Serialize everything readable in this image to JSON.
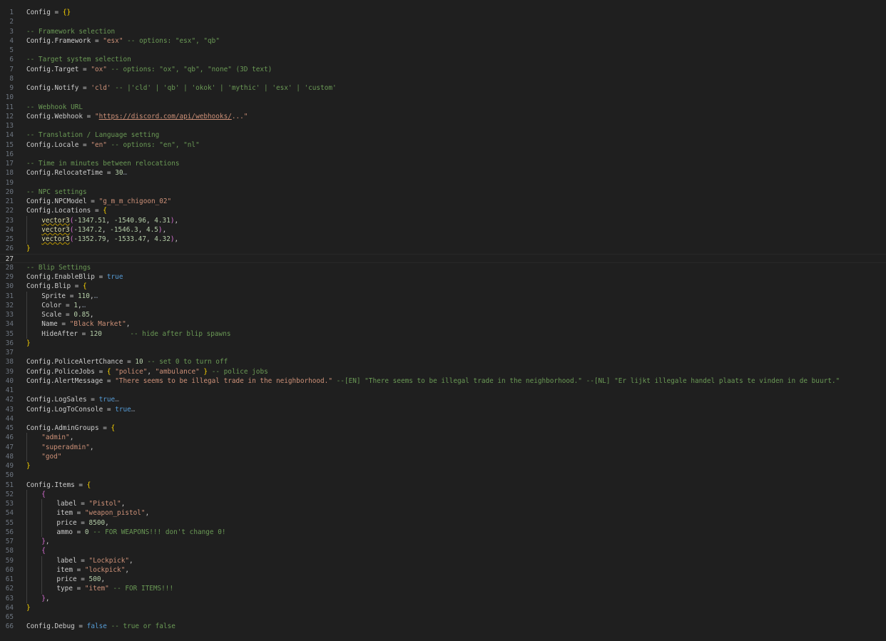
{
  "editor": {
    "colors": {
      "background": "#1f1f1f",
      "text": "#cccccc",
      "line_number": "#6e7681",
      "string": "#ce9178",
      "number": "#b5cea8",
      "comment": "#6a9955",
      "keyword": "#569cd6",
      "bracket_level1": "#ffd700",
      "bracket_level2": "#da70d6",
      "function": "#dcdcaa"
    },
    "current_line": 27,
    "lines": [
      {
        "n": 1,
        "indent": 0,
        "tokens": [
          [
            "id",
            "Config = "
          ],
          [
            "br1",
            "{}"
          ]
        ]
      },
      {
        "n": 2,
        "indent": 0,
        "tokens": []
      },
      {
        "n": 3,
        "indent": 0,
        "tokens": [
          [
            "cmt",
            "-- Framework selection"
          ]
        ]
      },
      {
        "n": 4,
        "indent": 0,
        "tokens": [
          [
            "id",
            "Config.Framework = "
          ],
          [
            "str",
            "\"esx\""
          ],
          [
            "id",
            " "
          ],
          [
            "cmt",
            "-- options: \"esx\", \"qb\""
          ]
        ]
      },
      {
        "n": 5,
        "indent": 0,
        "tokens": []
      },
      {
        "n": 6,
        "indent": 0,
        "tokens": [
          [
            "cmt",
            "-- Target system selection"
          ]
        ]
      },
      {
        "n": 7,
        "indent": 0,
        "tokens": [
          [
            "id",
            "Config.Target = "
          ],
          [
            "str",
            "\"ox\""
          ],
          [
            "id",
            " "
          ],
          [
            "cmt",
            "-- options: \"ox\", \"qb\", \"none\" (3D text)"
          ]
        ]
      },
      {
        "n": 8,
        "indent": 0,
        "tokens": []
      },
      {
        "n": 9,
        "indent": 0,
        "tokens": [
          [
            "id",
            "Config.Notify = "
          ],
          [
            "str",
            "'cld'"
          ],
          [
            "id",
            " "
          ],
          [
            "cmt",
            "-- |'cld' | 'qb' | 'okok' | 'mythic' | 'esx' | 'custom'"
          ]
        ]
      },
      {
        "n": 10,
        "indent": 0,
        "tokens": []
      },
      {
        "n": 11,
        "indent": 0,
        "tokens": [
          [
            "cmt",
            "-- Webhook URL"
          ]
        ]
      },
      {
        "n": 12,
        "indent": 0,
        "tokens": [
          [
            "id",
            "Config.Webhook = "
          ],
          [
            "str",
            "\""
          ],
          [
            "url",
            "https://discord.com/api/webhooks/"
          ],
          [
            "str",
            "...\""
          ]
        ]
      },
      {
        "n": 13,
        "indent": 0,
        "tokens": []
      },
      {
        "n": 14,
        "indent": 0,
        "tokens": [
          [
            "cmt",
            "-- Translation / Language setting"
          ]
        ]
      },
      {
        "n": 15,
        "indent": 0,
        "tokens": [
          [
            "id",
            "Config.Locale = "
          ],
          [
            "str",
            "\"en\""
          ],
          [
            "id",
            " "
          ],
          [
            "cmt",
            "-- options: \"en\", \"nl\""
          ]
        ]
      },
      {
        "n": 16,
        "indent": 0,
        "tokens": []
      },
      {
        "n": 17,
        "indent": 0,
        "tokens": [
          [
            "cmt",
            "-- Time in minutes between relocations"
          ]
        ]
      },
      {
        "n": 18,
        "indent": 0,
        "tokens": [
          [
            "id",
            "Config.RelocateTime = "
          ],
          [
            "num",
            "30"
          ],
          [
            "dots",
            "…"
          ]
        ]
      },
      {
        "n": 19,
        "indent": 0,
        "tokens": []
      },
      {
        "n": 20,
        "indent": 0,
        "tokens": [
          [
            "cmt",
            "-- NPC settings"
          ]
        ]
      },
      {
        "n": 21,
        "indent": 0,
        "tokens": [
          [
            "id",
            "Config.NPCModel = "
          ],
          [
            "str",
            "\"g_m_m_chigoon_02\""
          ]
        ]
      },
      {
        "n": 22,
        "indent": 0,
        "tokens": [
          [
            "id",
            "Config.Locations = "
          ],
          [
            "br1",
            "{"
          ]
        ]
      },
      {
        "n": 23,
        "indent": 1,
        "tokens": [
          [
            "fnsq",
            "vector3"
          ],
          [
            "br2",
            "("
          ],
          [
            "num",
            "-1347.51"
          ],
          [
            "id",
            ", "
          ],
          [
            "num",
            "-1540.96"
          ],
          [
            "id",
            ", "
          ],
          [
            "num",
            "4.31"
          ],
          [
            "br2",
            ")"
          ],
          [
            "id",
            ","
          ]
        ]
      },
      {
        "n": 24,
        "indent": 1,
        "tokens": [
          [
            "fnsq",
            "vector3"
          ],
          [
            "br2",
            "("
          ],
          [
            "num",
            "-1347.2"
          ],
          [
            "id",
            ", "
          ],
          [
            "num",
            "-1546.3"
          ],
          [
            "id",
            ", "
          ],
          [
            "num",
            "4.5"
          ],
          [
            "br2",
            ")"
          ],
          [
            "id",
            ","
          ]
        ]
      },
      {
        "n": 25,
        "indent": 1,
        "tokens": [
          [
            "fnsq",
            "vector3"
          ],
          [
            "br2",
            "("
          ],
          [
            "num",
            "-1352.79"
          ],
          [
            "id",
            ", "
          ],
          [
            "num",
            "-1533.47"
          ],
          [
            "id",
            ", "
          ],
          [
            "num",
            "4.32"
          ],
          [
            "br2",
            ")"
          ],
          [
            "id",
            ","
          ]
        ]
      },
      {
        "n": 26,
        "indent": 0,
        "tokens": [
          [
            "br1",
            "}"
          ]
        ]
      },
      {
        "n": 27,
        "indent": 0,
        "tokens": []
      },
      {
        "n": 28,
        "indent": 0,
        "tokens": [
          [
            "cmt",
            "-- Blip Settings"
          ]
        ]
      },
      {
        "n": 29,
        "indent": 0,
        "tokens": [
          [
            "id",
            "Config.EnableBlip = "
          ],
          [
            "kw",
            "true"
          ]
        ]
      },
      {
        "n": 30,
        "indent": 0,
        "tokens": [
          [
            "id",
            "Config.Blip = "
          ],
          [
            "br1",
            "{"
          ]
        ]
      },
      {
        "n": 31,
        "indent": 1,
        "tokens": [
          [
            "id",
            "Sprite = "
          ],
          [
            "num",
            "110"
          ],
          [
            "id",
            ","
          ],
          [
            "dots",
            "…"
          ]
        ]
      },
      {
        "n": 32,
        "indent": 1,
        "tokens": [
          [
            "id",
            "Color = "
          ],
          [
            "num",
            "1"
          ],
          [
            "id",
            ","
          ],
          [
            "dots",
            "…"
          ]
        ]
      },
      {
        "n": 33,
        "indent": 1,
        "tokens": [
          [
            "id",
            "Scale = "
          ],
          [
            "num",
            "0.85"
          ],
          [
            "id",
            ","
          ]
        ]
      },
      {
        "n": 34,
        "indent": 1,
        "tokens": [
          [
            "id",
            "Name = "
          ],
          [
            "str",
            "\"Black Market\""
          ],
          [
            "id",
            ","
          ]
        ]
      },
      {
        "n": 35,
        "indent": 1,
        "tokens": [
          [
            "id",
            "HideAfter = "
          ],
          [
            "num",
            "120"
          ],
          [
            "id",
            "       "
          ],
          [
            "cmt",
            "-- hide after blip spawns"
          ]
        ]
      },
      {
        "n": 36,
        "indent": 0,
        "tokens": [
          [
            "br1",
            "}"
          ]
        ]
      },
      {
        "n": 37,
        "indent": 0,
        "tokens": []
      },
      {
        "n": 38,
        "indent": 0,
        "tokens": [
          [
            "id",
            "Config.PoliceAlertChance = "
          ],
          [
            "num",
            "10"
          ],
          [
            "id",
            " "
          ],
          [
            "cmt",
            "-- set 0 to turn off"
          ]
        ]
      },
      {
        "n": 39,
        "indent": 0,
        "tokens": [
          [
            "id",
            "Config.PoliceJobs = "
          ],
          [
            "br1",
            "{"
          ],
          [
            "id",
            " "
          ],
          [
            "str",
            "\"police\""
          ],
          [
            "id",
            ", "
          ],
          [
            "str",
            "\"ambulance\""
          ],
          [
            "id",
            " "
          ],
          [
            "br1",
            "}"
          ],
          [
            "id",
            " "
          ],
          [
            "cmt",
            "-- police jobs"
          ]
        ]
      },
      {
        "n": 40,
        "indent": 0,
        "tokens": [
          [
            "id",
            "Config.AlertMessage = "
          ],
          [
            "str",
            "\"There seems to be illegal trade in the neighborhood.\""
          ],
          [
            "id",
            " "
          ],
          [
            "cmt",
            "--[EN] \"There seems to be illegal trade in the neighborhood.\" --[NL] \"Er lijkt illegale handel plaats te vinden in de buurt.\""
          ]
        ]
      },
      {
        "n": 41,
        "indent": 0,
        "tokens": []
      },
      {
        "n": 42,
        "indent": 0,
        "tokens": [
          [
            "id",
            "Config.LogSales = "
          ],
          [
            "kw",
            "true"
          ],
          [
            "dots",
            "…"
          ]
        ]
      },
      {
        "n": 43,
        "indent": 0,
        "tokens": [
          [
            "id",
            "Config.LogToConsole = "
          ],
          [
            "kw",
            "true"
          ],
          [
            "dots",
            "…"
          ]
        ]
      },
      {
        "n": 44,
        "indent": 0,
        "tokens": []
      },
      {
        "n": 45,
        "indent": 0,
        "tokens": [
          [
            "id",
            "Config.AdminGroups = "
          ],
          [
            "br1",
            "{"
          ]
        ]
      },
      {
        "n": 46,
        "indent": 1,
        "tokens": [
          [
            "str",
            "\"admin\""
          ],
          [
            "id",
            ","
          ]
        ]
      },
      {
        "n": 47,
        "indent": 1,
        "tokens": [
          [
            "str",
            "\"superadmin\""
          ],
          [
            "id",
            ","
          ]
        ]
      },
      {
        "n": 48,
        "indent": 1,
        "tokens": [
          [
            "str",
            "\"god\""
          ]
        ]
      },
      {
        "n": 49,
        "indent": 0,
        "tokens": [
          [
            "br1",
            "}"
          ]
        ]
      },
      {
        "n": 50,
        "indent": 0,
        "tokens": []
      },
      {
        "n": 51,
        "indent": 0,
        "tokens": [
          [
            "id",
            "Config.Items = "
          ],
          [
            "br1",
            "{"
          ]
        ]
      },
      {
        "n": 52,
        "indent": 1,
        "tokens": [
          [
            "br2",
            "{"
          ]
        ]
      },
      {
        "n": 53,
        "indent": 2,
        "tokens": [
          [
            "id",
            "label = "
          ],
          [
            "str",
            "\"Pistol\""
          ],
          [
            "id",
            ","
          ]
        ]
      },
      {
        "n": 54,
        "indent": 2,
        "tokens": [
          [
            "id",
            "item = "
          ],
          [
            "str",
            "\"weapon_pistol\""
          ],
          [
            "id",
            ","
          ]
        ]
      },
      {
        "n": 55,
        "indent": 2,
        "tokens": [
          [
            "id",
            "price = "
          ],
          [
            "num",
            "8500"
          ],
          [
            "id",
            ","
          ]
        ]
      },
      {
        "n": 56,
        "indent": 2,
        "tokens": [
          [
            "id",
            "ammo = "
          ],
          [
            "num",
            "0"
          ],
          [
            "id",
            " "
          ],
          [
            "cmt",
            "-- FOR WEAPONS!!! don't change 0!"
          ]
        ]
      },
      {
        "n": 57,
        "indent": 1,
        "tokens": [
          [
            "br2",
            "}"
          ],
          [
            "id",
            ","
          ]
        ]
      },
      {
        "n": 58,
        "indent": 1,
        "tokens": [
          [
            "br2",
            "{"
          ]
        ]
      },
      {
        "n": 59,
        "indent": 2,
        "tokens": [
          [
            "id",
            "label = "
          ],
          [
            "str",
            "\"Lockpick\""
          ],
          [
            "id",
            ","
          ]
        ]
      },
      {
        "n": 60,
        "indent": 2,
        "tokens": [
          [
            "id",
            "item = "
          ],
          [
            "str",
            "\"lockpick\""
          ],
          [
            "id",
            ","
          ]
        ]
      },
      {
        "n": 61,
        "indent": 2,
        "tokens": [
          [
            "id",
            "price = "
          ],
          [
            "num",
            "500"
          ],
          [
            "id",
            ","
          ]
        ]
      },
      {
        "n": 62,
        "indent": 2,
        "tokens": [
          [
            "id",
            "type = "
          ],
          [
            "str",
            "\"item\""
          ],
          [
            "id",
            " "
          ],
          [
            "cmt",
            "-- FOR ITEMS!!!"
          ]
        ]
      },
      {
        "n": 63,
        "indent": 1,
        "tokens": [
          [
            "br2",
            "}"
          ],
          [
            "id",
            ","
          ]
        ]
      },
      {
        "n": 64,
        "indent": 0,
        "tokens": [
          [
            "br1",
            "}"
          ]
        ]
      },
      {
        "n": 65,
        "indent": 0,
        "tokens": []
      },
      {
        "n": 66,
        "indent": 0,
        "tokens": [
          [
            "id",
            "Config.Debug = "
          ],
          [
            "kw",
            "false"
          ],
          [
            "id",
            " "
          ],
          [
            "cmt",
            "-- true or false"
          ]
        ]
      }
    ]
  }
}
